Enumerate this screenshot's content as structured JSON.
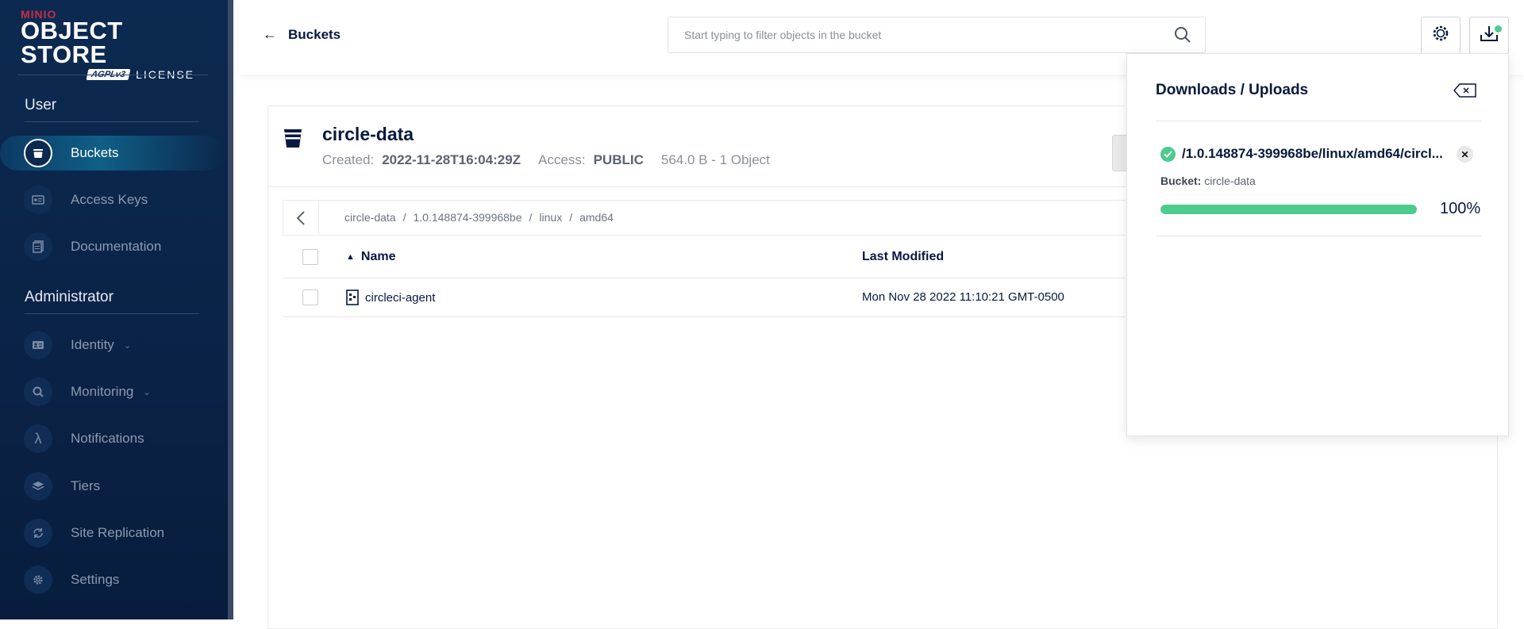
{
  "brand": {
    "minio": "MINIO",
    "product": "OBJECT STORE",
    "agpl": "AGPLv3",
    "license": "LICENSE"
  },
  "sidebar": {
    "user_section": "User",
    "admin_section": "Administrator",
    "user_items": [
      {
        "label": "Buckets",
        "icon": "bucket-icon",
        "active": true
      },
      {
        "label": "Access Keys",
        "icon": "key-card-icon"
      },
      {
        "label": "Documentation",
        "icon": "document-icon"
      }
    ],
    "admin_items": [
      {
        "label": "Identity",
        "icon": "id-card-icon",
        "expandable": true
      },
      {
        "label": "Monitoring",
        "icon": "magnifier-icon",
        "expandable": true
      },
      {
        "label": "Notifications",
        "icon": "lambda-icon"
      },
      {
        "label": "Tiers",
        "icon": "layers-icon"
      },
      {
        "label": "Site Replication",
        "icon": "sync-icon"
      },
      {
        "label": "Settings",
        "icon": "gear-icon"
      }
    ]
  },
  "header": {
    "back_label": "Buckets",
    "search_placeholder": "Start typing to filter objects in the bucket"
  },
  "bucket": {
    "name": "circle-data",
    "created_label": "Created:",
    "created_value": "2022-11-28T16:04:29Z",
    "access_label": "Access:",
    "access_value": "PUBLIC",
    "size_info": "564.0 B - 1 Object"
  },
  "breadcrumb": [
    "circle-data",
    "1.0.148874-399968be",
    "linux",
    "amd64"
  ],
  "table": {
    "columns": {
      "name": "Name",
      "last_modified": "Last Modified"
    },
    "rows": [
      {
        "name": "circleci-agent",
        "last_modified": "Mon Nov 28 2022 11:10:21 GMT-0500"
      }
    ]
  },
  "downloads": {
    "title": "Downloads / Uploads",
    "items": [
      {
        "path": "/1.0.148874-399968be/linux/amd64/circl...",
        "bucket_label": "Bucket:",
        "bucket_name": "circle-data",
        "progress": 100,
        "progress_text": "100%"
      }
    ]
  },
  "colors": {
    "sidebar_bg": "#0c2a51",
    "accent_green": "#4ccb8d",
    "brand_red": "#c72e49",
    "text_dark": "#07193e"
  }
}
